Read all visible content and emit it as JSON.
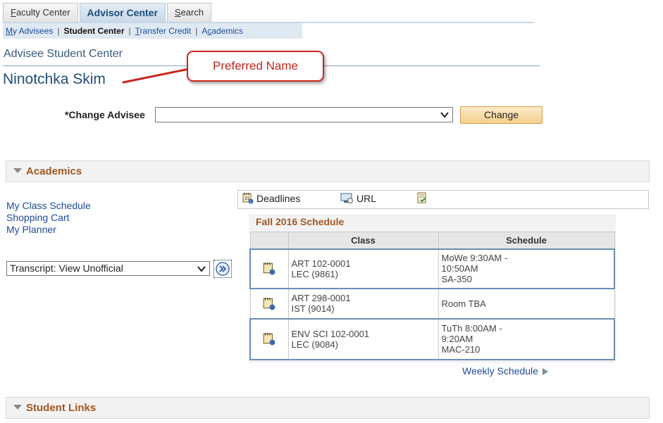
{
  "tabs": [
    {
      "label": "Faculty Center",
      "underline_char": "F",
      "rest": "aculty Center",
      "active": false
    },
    {
      "label": "Advisor Center",
      "active": true
    },
    {
      "label": "Search",
      "underline_char": "S",
      "rest": "earch",
      "active": false
    }
  ],
  "subnav": {
    "my_advisees": {
      "u": "M",
      "rest": "y Advisees"
    },
    "student_center": "Student Center",
    "transfer_credit": {
      "u": "T",
      "rest": "ransfer Credit"
    },
    "academics": {
      "pre": "A",
      "u": "c",
      "rest": "ademics"
    },
    "separator": "|"
  },
  "header": {
    "title": "Advisee Student Center",
    "student_name": "Ninotchka Skim",
    "callout": "Preferred Name"
  },
  "change_advisee": {
    "label": "*Change Advisee",
    "value": "",
    "button": "Change"
  },
  "sections": {
    "academics": "Academics",
    "student_links": "Student Links"
  },
  "left_links": [
    "My Class Schedule",
    "Shopping Cart",
    "My Planner"
  ],
  "transcript_select": {
    "value": "Transcript: View Unofficial"
  },
  "tools": {
    "deadlines": "Deadlines",
    "url": "URL"
  },
  "schedule": {
    "title": "Fall 2016 Schedule",
    "headers": [
      "Class",
      "Schedule"
    ],
    "rows": [
      {
        "class_line1": "ART 102-0001",
        "class_line2": "LEC (9861)",
        "sched_line1": "MoWe 9:30AM -",
        "sched_line2": "10:50AM",
        "sched_line3": "SA-350"
      },
      {
        "class_line1": "ART 298-0001",
        "class_line2": "IST (9014)",
        "sched_line1": "Room  TBA",
        "sched_line2": "",
        "sched_line3": ""
      },
      {
        "class_line1": "ENV SCI 102-0001",
        "class_line2": "LEC (9084)",
        "sched_line1": "TuTh 8:00AM -",
        "sched_line2": "9:20AM",
        "sched_line3": "MAC-210"
      }
    ],
    "weekly_link": "Weekly Schedule"
  },
  "colors": {
    "section_title": "#a05722",
    "link": "#1c4b9a",
    "callout": "#c8261d",
    "row_border": "#6b8eb4"
  }
}
